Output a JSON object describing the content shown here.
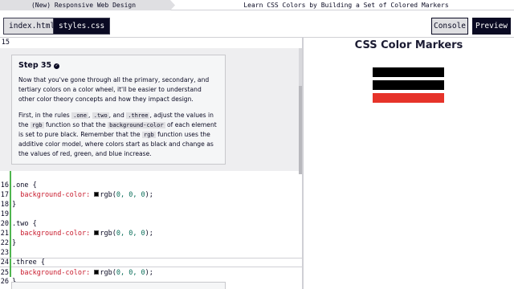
{
  "breadcrumb": {
    "course": "(New) Responsive Web Design",
    "project": "Learn CSS Colors by Building a Set of Colored Markers"
  },
  "tabs": [
    {
      "label": "index.html",
      "active": false
    },
    {
      "label": "styles.css",
      "active": true
    }
  ],
  "buttons": {
    "console": "Console",
    "preview": "Preview"
  },
  "editor": {
    "top_line_number": "15",
    "step": {
      "title": "Step 35",
      "check_icon": "check-circle-icon",
      "p1": "Now that you've gone through all the primary, secondary, and tertiary colors on a color wheel, it'll be easier to understand other color theory concepts and how they impact design.",
      "p2_a": "First, in the rules ",
      "chip_one": ".one",
      "p2_b": ", ",
      "chip_two": ".two",
      "p2_c": ", and ",
      "chip_three": ".three",
      "p2_d": ", adjust the values in the ",
      "chip_rgb": "rgb",
      "p2_e": " function so that the ",
      "chip_bg": "background-color",
      "p2_f": " of each element is set to pure black. Remember that the ",
      "chip_rgb2": "rgb",
      "p2_g": " function uses the additive color model, where colors start as black and change as the values of red, green, and blue increase."
    },
    "code_lines": [
      {
        "n": "16",
        "text": ".one {"
      },
      {
        "n": "17",
        "prop": "  background-color: ",
        "func": "rgb(",
        "args": "0, 0, 0",
        "end": ");"
      },
      {
        "n": "18",
        "text": "}"
      },
      {
        "n": "19",
        "text": ""
      },
      {
        "n": "20",
        "text": ".two {"
      },
      {
        "n": "21",
        "prop": "  background-color: ",
        "func": "rgb(",
        "args": "0, 0, 0",
        "end": ");"
      },
      {
        "n": "22",
        "text": "}"
      },
      {
        "n": "23",
        "text": ""
      },
      {
        "n": "24",
        "text": ".three {"
      },
      {
        "n": "25",
        "prop": "  background-color: ",
        "func": "rgb(",
        "args": "0, 0, 0",
        "end": ");"
      },
      {
        "n": "26",
        "text": "}"
      }
    ]
  },
  "preview": {
    "title": "CSS Color Markers",
    "markers": [
      {
        "name": "one",
        "color": "#000000"
      },
      {
        "name": "two",
        "color": "#000000"
      },
      {
        "name": "three",
        "color": "#e6332a"
      }
    ]
  },
  "colors": {
    "accent_dark": "#0a0a23",
    "gutter_changed": "#4fb54f"
  }
}
